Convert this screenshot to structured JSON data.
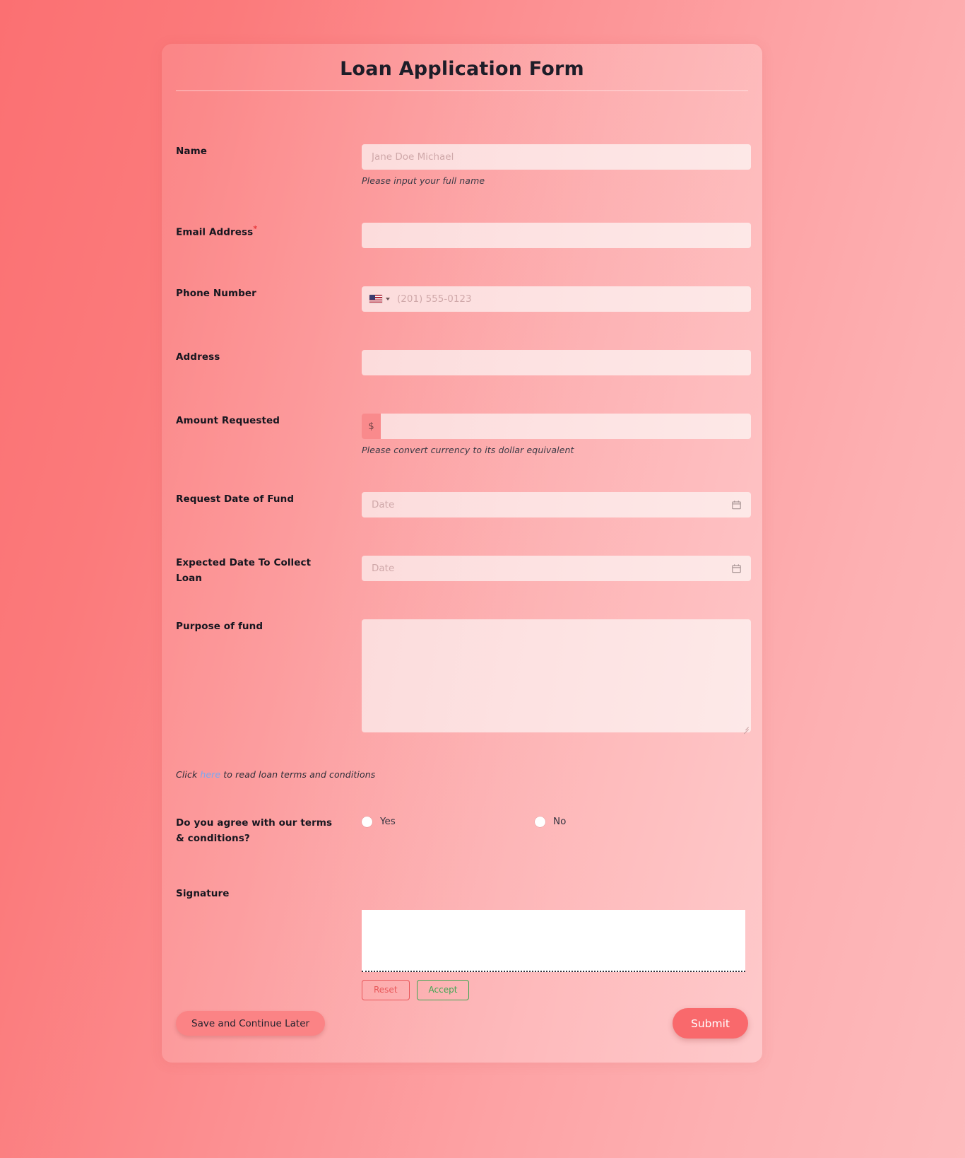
{
  "form": {
    "title": "Loan Application Form",
    "fields": [
      {
        "key": "name",
        "label": "Name",
        "required": false,
        "placeholder": "Jane Doe Michael",
        "value": "",
        "helper": "Please input your full name"
      },
      {
        "key": "email",
        "label": "Email Address",
        "required": true,
        "required_marker": "*",
        "placeholder": "",
        "value": "",
        "helper": ""
      },
      {
        "key": "phone",
        "label": "Phone Number",
        "required": false,
        "placeholder": "(201) 555-0123",
        "value": "",
        "helper": "",
        "country_flag": "us-flag-icon",
        "dropdown_icon": "caret-down-icon"
      },
      {
        "key": "address",
        "label": "Address",
        "required": false,
        "placeholder": "",
        "value": "",
        "helper": ""
      },
      {
        "key": "amount",
        "label": "Amount Requested",
        "required": false,
        "prefix": "$",
        "placeholder": "",
        "value": "",
        "helper": "Please convert currency to its dollar equivalent"
      },
      {
        "key": "request_date",
        "label": "Request Date of Fund",
        "required": false,
        "placeholder": "Date",
        "value": "",
        "helper": "",
        "icon": "calendar-icon"
      },
      {
        "key": "collect_date",
        "label": "Expected Date To Collect Loan",
        "required": false,
        "placeholder": "Date",
        "value": "",
        "helper": "",
        "icon": "calendar-icon"
      },
      {
        "key": "purpose",
        "label": "Purpose of fund",
        "required": false,
        "placeholder": "",
        "value": "",
        "helper": ""
      }
    ],
    "terms": {
      "prefix": "Click ",
      "link_text": "here",
      "suffix": " to read loan terms and conditions",
      "link_color": "#76a9f5"
    },
    "agree": {
      "label": "Do you agree with our terms & conditions?",
      "options": [
        {
          "value": "yes",
          "label": "Yes",
          "selected": false
        },
        {
          "value": "no",
          "label": "No",
          "selected": false
        }
      ]
    },
    "signature": {
      "label": "Signature",
      "value": "",
      "reset_label": "Reset",
      "accept_label": "Accept",
      "reset_color": "#e8585a",
      "accept_color": "#3fa552"
    },
    "actions": {
      "save_label": "Save and Continue Later",
      "submit_label": "Submit"
    }
  },
  "theme": {
    "background_start": "#fb7072",
    "background_end": "#fdbbbd",
    "accent": "#f9696c",
    "input_background": "#fcdcdc",
    "required_color": "#e8393c"
  }
}
